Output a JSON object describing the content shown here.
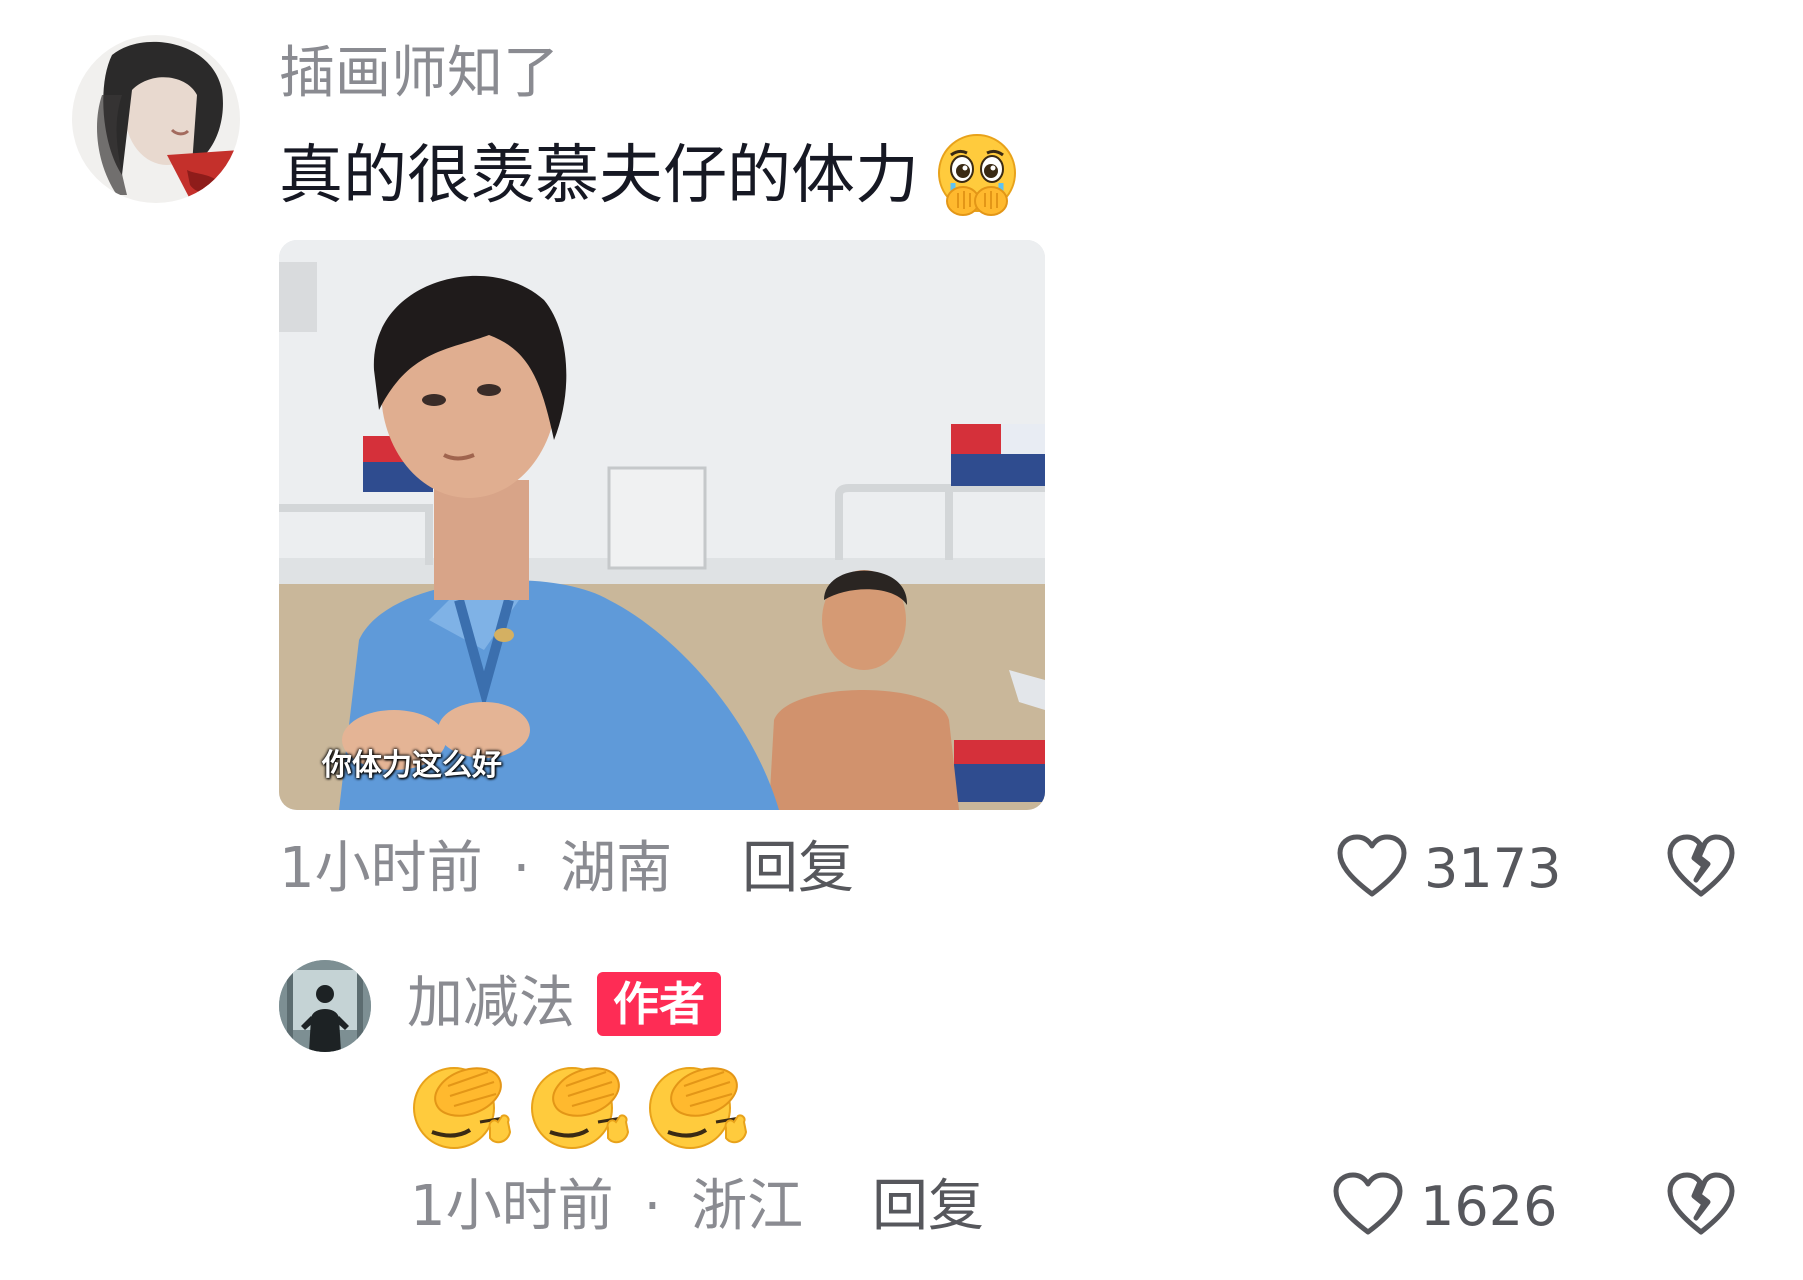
{
  "comments": [
    {
      "username": "插画师知了",
      "text": "真的很羡慕夫仔的体力",
      "text_emoji": "pleading-face-hands-over-mouth-icon",
      "attachment": {
        "subtitle": "你体力这么好"
      },
      "time": "1小时前",
      "separator": "·",
      "location": "湖南",
      "reply_label": "回复",
      "likes": "3173"
    },
    {
      "username": "加减法",
      "badge": "作者",
      "text_emojis": [
        "facepalm-icon",
        "facepalm-icon",
        "facepalm-icon"
      ],
      "time": "1小时前",
      "separator": "·",
      "location": "浙江",
      "reply_label": "回复",
      "likes": "1626"
    }
  ],
  "colors": {
    "username": "#8a8b91",
    "text": "#161823",
    "meta": "#8a8b91",
    "reply": "#56575c",
    "badge_bg": "#fe2c55",
    "badge_text": "#ffffff"
  }
}
